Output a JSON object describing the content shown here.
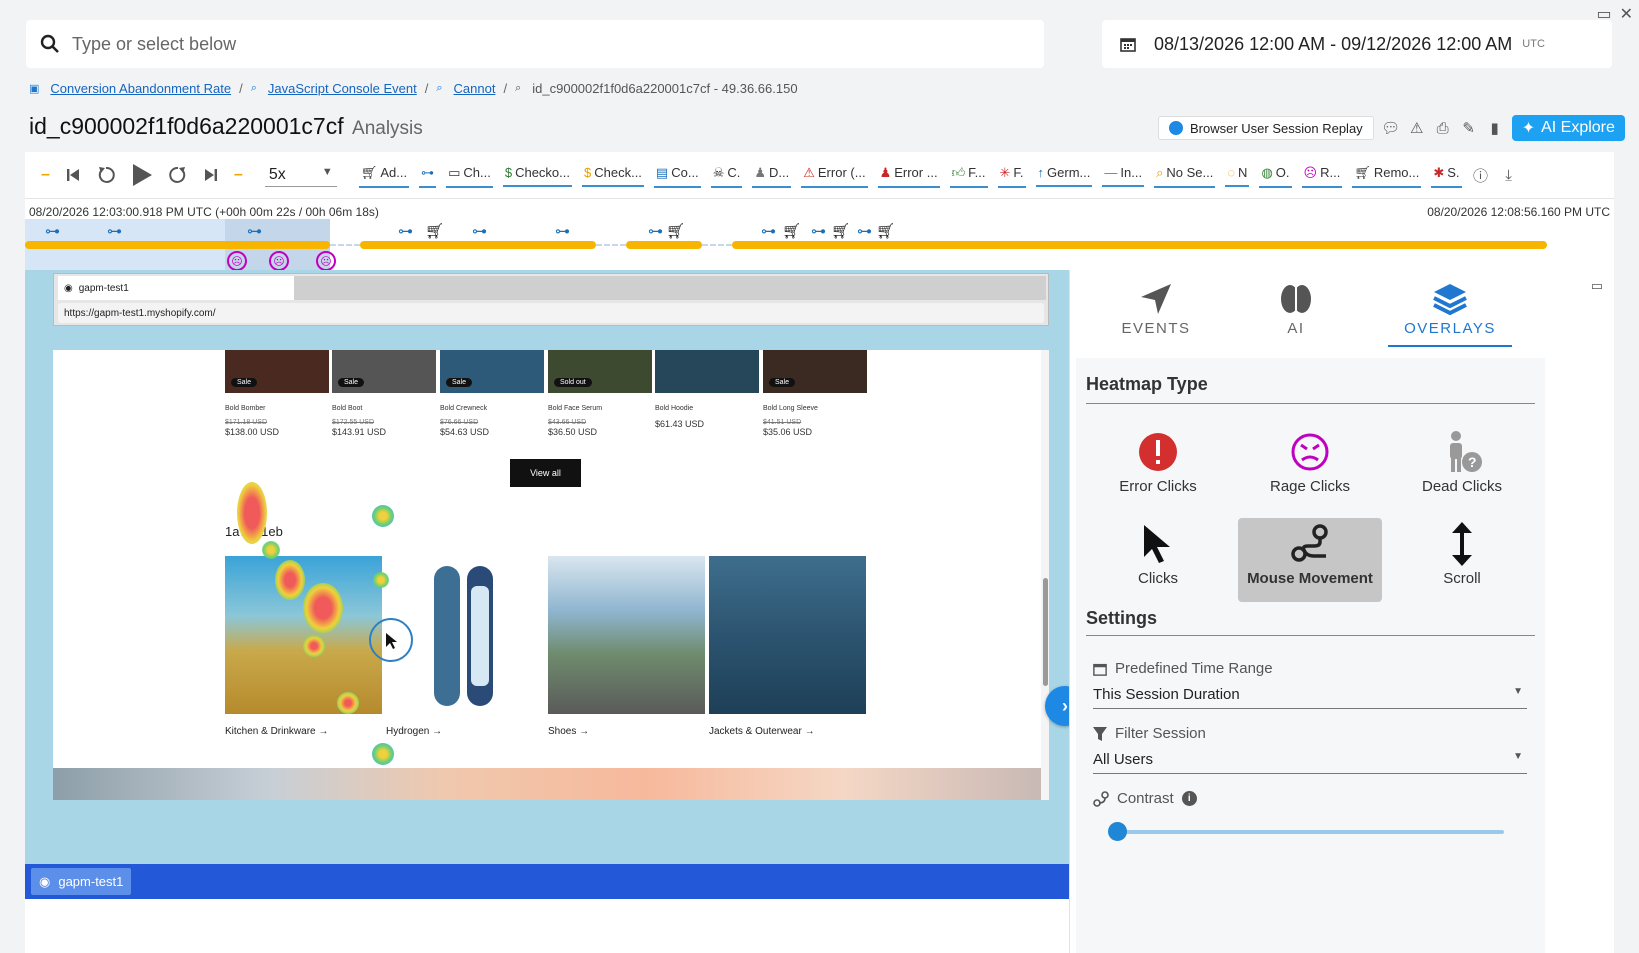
{
  "search": {
    "placeholder": "Type or select below"
  },
  "daterange": {
    "text": "08/13/2026 12:00 AM - 09/12/2026 12:00 AM",
    "tz": "UTC"
  },
  "breadcrumb": [
    {
      "label": "Conversion Abandonment Rate"
    },
    {
      "label": "JavaScript Console Event"
    },
    {
      "label": "Cannot"
    },
    {
      "label": "id_c900002f1f0d6a220001c7cf - 49.36.66.150"
    }
  ],
  "title": {
    "main": "id_c900002f1f0d6a220001c7cf",
    "sub": "Analysis"
  },
  "tools": {
    "replay_label": "Browser User Session Replay",
    "ai_explore": "AI Explore"
  },
  "player": {
    "speed": "5x"
  },
  "events": [
    "Ad...",
    "",
    "Ch...",
    "Checko...",
    "Check...",
    "Co...",
    "C.",
    "D...",
    "Error (...",
    "Error ...",
    "F...",
    "F.",
    "Germ...",
    "In...",
    "No Se...",
    "N",
    "O.",
    "R...",
    "Remo...",
    "S."
  ],
  "timeline": {
    "start": "08/20/2026 12:03:00.918 PM UTC (+00h 00m 22s / 00h 06m 18s)",
    "end": "08/20/2026 12:08:56.160 PM UTC"
  },
  "browser": {
    "tab_title": "gapm-test1",
    "url": "https://gapm-test1.myshopify.com/"
  },
  "products": [
    {
      "name": "Bold Bomber",
      "badge": "Sale",
      "old": "$171.18 USD",
      "price": "$138.00 USD",
      "color": "#4a2a20"
    },
    {
      "name": "Bold Boot",
      "badge": "Sale",
      "old": "$172.55 USD",
      "price": "$143.91 USD",
      "color": "#555555"
    },
    {
      "name": "Bold Crewneck",
      "badge": "Sale",
      "old": "$76.66 USD",
      "price": "$54.63 USD",
      "color": "#2d5a78"
    },
    {
      "name": "Bold Face Serum",
      "badge": "Sold out",
      "old": "$43.66 USD",
      "price": "$36.50 USD",
      "color": "#3d4a30"
    },
    {
      "name": "Bold Hoodie",
      "badge": "",
      "old": "",
      "price": "$61.43 USD",
      "color": "#26475a"
    },
    {
      "name": "Bold Long Sleeve",
      "badge": "Sale",
      "old": "$41.51 USD",
      "price": "$35.06 USD",
      "color": "#3a2a22"
    }
  ],
  "view_all": "View all",
  "shop_name": "1a7341eb",
  "collections": [
    "Kitchen & Drinkware →",
    "Hydrogen →",
    "Shoes →",
    "Jackets & Outerwear →"
  ],
  "footer_tab": "gapm-test1",
  "panel": {
    "tabs": [
      "EVENTS",
      "AI",
      "OVERLAYS"
    ],
    "heatmap_title": "Heatmap Type",
    "heatmap_types": [
      "Error Clicks",
      "Rage Clicks",
      "Dead Clicks",
      "Clicks",
      "Mouse Movement",
      "Scroll"
    ],
    "selected_type": "Mouse Movement",
    "settings_title": "Settings",
    "time_range_label": "Predefined Time Range",
    "time_range_value": "This Session Duration",
    "filter_label": "Filter Session",
    "filter_value": "All Users",
    "contrast_label": "Contrast",
    "contrast_value": 0
  },
  "colors": {
    "accent": "#1f77d0",
    "timeline_bar": "#f7b500",
    "footer": "#2358d8",
    "replay_bg": "#a8d6e6"
  }
}
